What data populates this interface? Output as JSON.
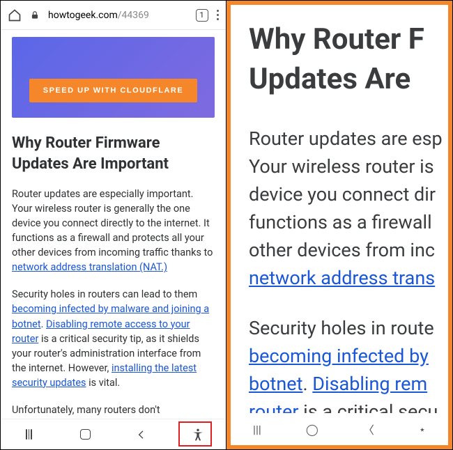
{
  "browser": {
    "domain": "howtogeek.com",
    "path": "/44369",
    "tab_count": "1"
  },
  "banner": {
    "cta": "SPEED UP WITH CLOUDFLARE"
  },
  "article": {
    "heading": "Why Router Firmware Updates Are Important",
    "p1_a": "Router updates are especially important. Your wireless router is generally the one device you connect directly to the internet. It functions as a firewall and protects all your other devices from incoming traffic thanks to ",
    "p1_link": "network address translation (NAT.)",
    "p2_a": "Security holes in routers can lead to them ",
    "p2_link1": "becoming infected by malware and joining a botnet",
    "p2_b": ". ",
    "p2_link2": "Disabling remote access to your router",
    "p2_c": " is a critical security tip, as it shields your router's administration interface from the internet. However, ",
    "p2_link3": "installing the latest security updates",
    "p2_d": " is vital.",
    "p3": "Unfortunately, many routers don't automatically install security updates and"
  },
  "zoom": {
    "heading_l1": "Why Router F",
    "heading_l2": "Updates Are ",
    "p1_l1": "Router updates are esp",
    "p1_l2": "Your wireless router is",
    "p1_l3": "device you connect dir",
    "p1_l4": "functions as a firewall ",
    "p1_l5": "other devices from inc",
    "p1_link": "network address trans",
    "p2_l1": "Security holes in route",
    "p2_link1": "becoming infected by ",
    "p2_link2_a": "botnet",
    "p2_link2_b": "Disabling rem",
    "p2_link3": "router",
    "p2_tail": " is a critical secu"
  }
}
